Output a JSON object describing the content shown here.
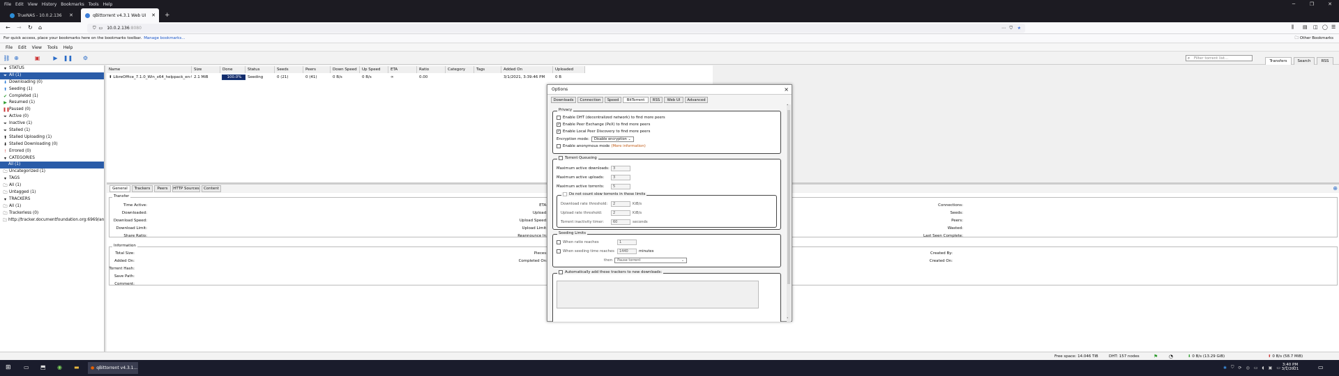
{
  "firefox": {
    "menu": [
      "File",
      "Edit",
      "View",
      "History",
      "Bookmarks",
      "Tools",
      "Help"
    ],
    "tabs": [
      {
        "title": "TrueNAS - 10.0.2.136"
      },
      {
        "title": "qBittorrent v4.3.1 Web UI"
      }
    ],
    "new_tab": "+",
    "url_host": "10.0.2.136",
    "url_port": ":8080",
    "bookmarks_text": "For quick access, place your bookmarks here on the bookmarks toolbar.",
    "bookmarks_link": "Manage bookmarks...",
    "other_bookmarks": "Other Bookmarks"
  },
  "qbt": {
    "menu": [
      "File",
      "Edit",
      "View",
      "Tools",
      "Help"
    ],
    "filter_placeholder": "Filter torrent list...",
    "right_tabs": [
      "Transfers",
      "Search",
      "RSS"
    ],
    "sidebar": {
      "status_header": "STATUS",
      "status_items": [
        {
          "label": "All (1)",
          "icon": "filter",
          "color": "#fff"
        },
        {
          "label": "Downloading (0)",
          "icon": "down-arrow",
          "color": "#2a7ad8"
        },
        {
          "label": "Seeding (1)",
          "icon": "up-arrow",
          "color": "#2a7ad8"
        },
        {
          "label": "Completed (1)",
          "icon": "check",
          "color": "#2a9a2a"
        },
        {
          "label": "Resumed (1)",
          "icon": "play",
          "color": "#2a9a2a"
        },
        {
          "label": "Paused (0)",
          "icon": "pause",
          "color": "#cc3333"
        },
        {
          "label": "Active (0)",
          "icon": "filter",
          "color": "#333"
        },
        {
          "label": "Inactive (1)",
          "icon": "filter",
          "color": "#333"
        },
        {
          "label": "Stalled (1)",
          "icon": "filter",
          "color": "#333"
        },
        {
          "label": "Stalled Uploading (1)",
          "icon": "up-arrow",
          "color": "#111"
        },
        {
          "label": "Stalled Downloading (0)",
          "icon": "down-arrow",
          "color": "#111"
        },
        {
          "label": "Errored (0)",
          "icon": "error",
          "color": "#cc3333"
        }
      ],
      "categories_header": "CATEGORIES",
      "categories": [
        "All (1)",
        "Uncategorized (1)"
      ],
      "tags_header": "TAGS",
      "tags": [
        "All (1)",
        "Untagged (1)"
      ],
      "trackers_header": "TRACKERS",
      "trackers": [
        "All (1)",
        "Trackerless (0)",
        "http://tracker.documentfoundation.org:6969/anno..."
      ]
    },
    "columns": [
      "Name",
      "Size",
      "Done",
      "Status",
      "Seeds",
      "Peers",
      "Down Speed",
      "Up Speed",
      "ETA",
      "Ratio",
      "Category",
      "Tags",
      "Added On",
      "Uploaded"
    ],
    "torrent": {
      "name": "LibreOffice_7.1.0_Win_x64_helppack_en-US.msi",
      "size": "2.1 MiB",
      "done": "100.0%",
      "done_fraction": 1.0,
      "status": "Seeding",
      "seeds": "0 (21)",
      "peers": "0 (41)",
      "down": "0 B/s",
      "up": "0 B/s",
      "eta": "∞",
      "ratio": "0.00",
      "category": "",
      "tags": "",
      "added": "3/1/2021, 3:39:46 PM",
      "uploaded": "0 B"
    },
    "bottom_tabs": [
      "General",
      "Trackers",
      "Peers",
      "HTTP Sources",
      "Content"
    ],
    "transfer": {
      "legend": "Transfer",
      "left": [
        "Time Active:",
        "Downloaded:",
        "Download Speed:",
        "Download Limit:",
        "Share Ratio:"
      ],
      "mid": [
        "ETA:",
        "Upload:",
        "Upload Speed:",
        "Upload Limit:",
        "Reannounce In:"
      ],
      "right": [
        "Connections:",
        "Seeds:",
        "Peers:",
        "Wasted:",
        "Last Seen Complete:"
      ]
    },
    "information": {
      "legend": "Information",
      "left": [
        "Total Size:",
        "Added On:",
        "Torrent Hash:",
        "Save Path:",
        "Comment:"
      ],
      "mid": [
        "Pieces:",
        "Completed On:"
      ],
      "right": [
        "Created By:",
        "Created On:"
      ]
    },
    "status": {
      "free_space": "Free space: 14.046 TiB",
      "dht": "DHT: 157 nodes",
      "down": "0 B/s (13.29 GiB)",
      "up": "0 B/s (58.7 MiB)"
    }
  },
  "options": {
    "title": "Options",
    "close": "×",
    "tabs": [
      "Downloads",
      "Connection",
      "Speed",
      "BitTorrent",
      "RSS",
      "Web UI",
      "Advanced"
    ],
    "privacy": {
      "legend": "Privacy",
      "dht": "Enable DHT (decentralized network) to find more peers",
      "pex": "Enable Peer Exchange (PeX) to find more peers",
      "lpd": "Enable Local Peer Discovery to find more peers",
      "enc_label": "Encryption mode:",
      "enc_value": "Disable encryption",
      "anon": "Enable anonymous mode",
      "anon_link": "(More information)"
    },
    "queue": {
      "legend": "Torrent Queueing",
      "max_dl_label": "Maximum active downloads:",
      "max_dl": "3",
      "max_ul_label": "Maximum active uploads:",
      "max_ul": "3",
      "max_t_label": "Maximum active torrents:",
      "max_t": "5",
      "slow_legend": "Do not count slow torrents in these limits",
      "dl_thr_label": "Download rate threshold:",
      "dl_thr": "2",
      "dl_unit": "KiB/s",
      "ul_thr_label": "Upload rate threshold:",
      "ul_thr": "2",
      "ul_unit": "KiB/s",
      "inact_label": "Torrent inactivity timer:",
      "inact": "60",
      "inact_unit": "seconds"
    },
    "seeding": {
      "legend": "Seeding Limits",
      "ratio_label": "When ratio reaches",
      "ratio": "1",
      "time_label": "When seeding time reaches",
      "time": "1440",
      "time_unit": "minutes",
      "then": "then",
      "action": "Pause torrent"
    },
    "trackers": {
      "legend": "Automatically add these trackers to new downloads:"
    }
  },
  "taskbar": {
    "app": "qBittorrent v4.3.1...",
    "time": "3:40 PM",
    "date": "3/1/2021"
  }
}
